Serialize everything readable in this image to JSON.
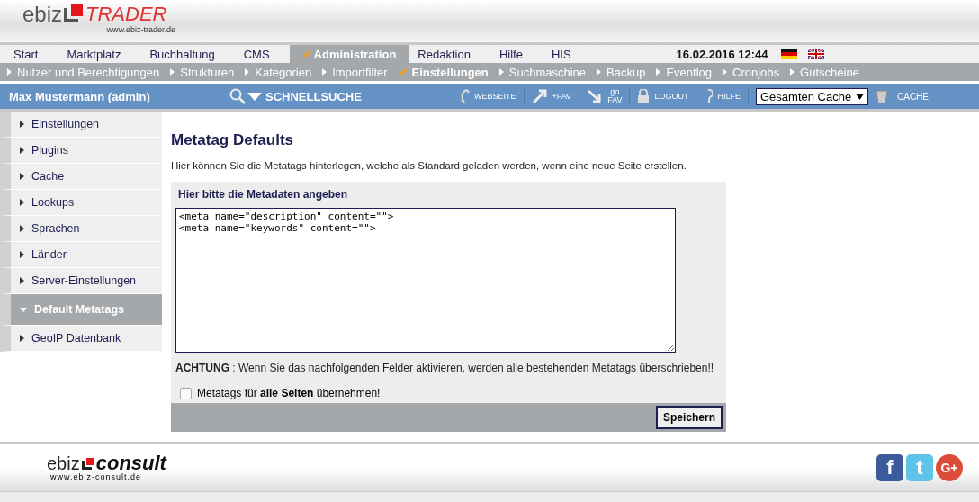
{
  "header": {
    "logo_left": "ebiz",
    "logo_right": "TRADER",
    "logo_url": "www.ebiz-trader.de"
  },
  "main_nav": [
    {
      "label": "Start",
      "selected": false
    },
    {
      "label": "Marktplatz",
      "selected": false
    },
    {
      "label": "Buchhaltung",
      "selected": false
    },
    {
      "label": "CMS",
      "selected": false
    },
    {
      "label": "Administration",
      "selected": true
    },
    {
      "label": "Redaktion",
      "selected": false
    },
    {
      "label": "Hilfe",
      "selected": false
    },
    {
      "label": "HIS",
      "selected": false
    }
  ],
  "datetime": "16.02.2016 12:44",
  "sub_nav": [
    {
      "label": "Nutzer und Berechtigungen",
      "selected": false
    },
    {
      "label": "Strukturen",
      "selected": false
    },
    {
      "label": "Kategorien",
      "selected": false
    },
    {
      "label": "Importfilter",
      "selected": false
    },
    {
      "label": "Einstellungen",
      "selected": true
    },
    {
      "label": "Suchmaschine",
      "selected": false
    },
    {
      "label": "Backup",
      "selected": false
    },
    {
      "label": "Eventlog",
      "selected": false
    },
    {
      "label": "Cronjobs",
      "selected": false
    },
    {
      "label": "Gutscheine",
      "selected": false
    }
  ],
  "toolbar": {
    "user": "Max Mustermann (admin)",
    "quicksearch": "SCHNELLSUCHE",
    "links": [
      {
        "kind": "web",
        "label": "WEBSEITE"
      },
      {
        "kind": "addfav",
        "label": "+FAV"
      },
      {
        "kind": "gofav",
        "label": "go",
        "label2": "FAV"
      },
      {
        "kind": "logout",
        "label": "LOGOUT"
      },
      {
        "kind": "help",
        "label": "HILFE"
      }
    ],
    "cache_select": "Gesamten Cache",
    "cache_button": "CACHE"
  },
  "sidebar": {
    "items": [
      {
        "label": "Einstellungen",
        "selected": false
      },
      {
        "label": "Plugins",
        "selected": false
      },
      {
        "label": "Cache",
        "selected": false
      },
      {
        "label": "Lookups",
        "selected": false
      },
      {
        "label": "Sprachen",
        "selected": false
      },
      {
        "label": "Länder",
        "selected": false
      },
      {
        "label": "Server-Einstellungen",
        "selected": false
      },
      {
        "label": "Default Metatags",
        "selected": true
      },
      {
        "label": "GeoIP Datenbank",
        "selected": false
      }
    ]
  },
  "content": {
    "title": "Metatag Defaults",
    "intro": "Hier können Sie die Metatags hinterlegen, welche als Standard geladen werden, wenn eine neue Seite erstellen.",
    "form_title": "Hier bitte die Metadaten angeben",
    "meta_value": "<meta name=\"description\" content=\"\">\n<meta name=\"keywords\" content=\"\">",
    "warning": "**ACHTUNG** : Wenn Sie das nachfolgenden Felder aktivieren, werden alle bestehenden Metatags überschrieben!!",
    "checkbox_label": "Metatags für **alle Seiten** übernehmen!",
    "checkbox_checked": false,
    "save": "Speichern"
  },
  "footer": {
    "logo_left": "ebiz",
    "logo_right": "consult",
    "logo_url": "www.ebiz-consult.de",
    "social": [
      {
        "kind": "facebook",
        "glyph": "f"
      },
      {
        "kind": "twitter",
        "glyph": "t"
      },
      {
        "kind": "google",
        "glyph": "G+"
      }
    ]
  }
}
